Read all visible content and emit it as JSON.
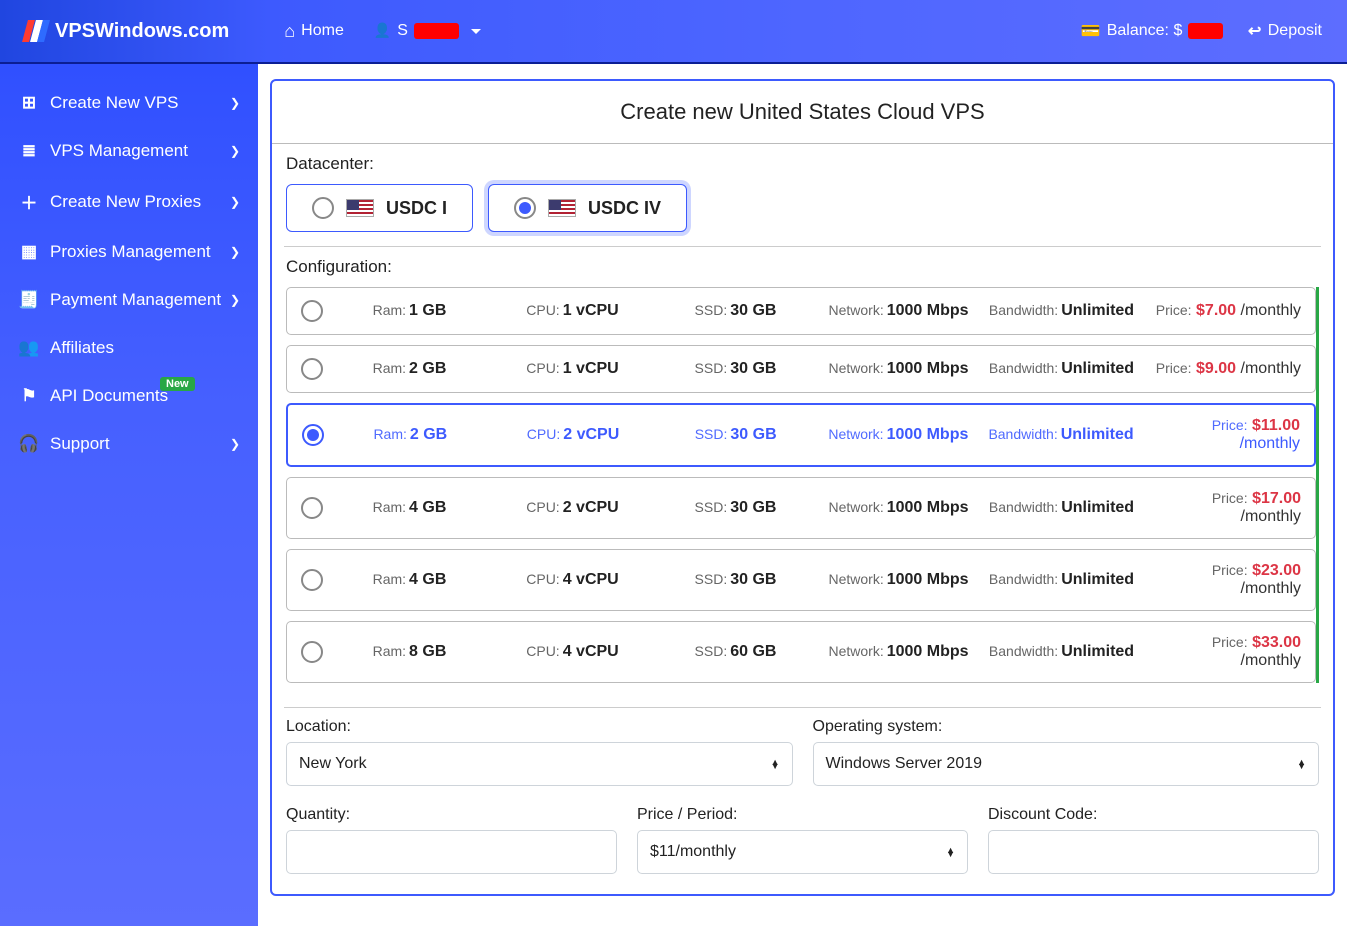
{
  "brand": "VPSWindows.com",
  "topnav": {
    "home": "Home",
    "balance_label": "Balance: $",
    "deposit": "Deposit"
  },
  "sidebar": {
    "items": [
      {
        "icon": "⊞",
        "label": "Create New VPS",
        "chev": true
      },
      {
        "icon": "≣",
        "label": "VPS Management",
        "chev": true
      },
      {
        "icon": "＋",
        "label": "Create New Proxies",
        "chev": true
      },
      {
        "icon": "▦",
        "label": "Proxies Management",
        "chev": true
      },
      {
        "icon": "🧾",
        "label": "Payment Management",
        "chev": true
      },
      {
        "icon": "👥",
        "label": "Affiliates",
        "chev": false
      },
      {
        "icon": "⚑",
        "label": "API Documents",
        "chev": false,
        "badge": "New"
      },
      {
        "icon": "🎧",
        "label": "Support",
        "chev": true
      }
    ]
  },
  "page": {
    "title": "Create new United States Cloud VPS",
    "datacenter_label": "Datacenter:",
    "datacenters": [
      {
        "name": "USDC I",
        "selected": false
      },
      {
        "name": "USDC IV",
        "selected": true
      }
    ],
    "config_label": "Configuration:",
    "configs": [
      {
        "ram": "1 GB",
        "cpu": "1 vCPU",
        "ssd": "30 GB",
        "net": "1000 Mbps",
        "bw": "Unlimited",
        "price": "$7.00",
        "period": "/monthly",
        "selected": false
      },
      {
        "ram": "2 GB",
        "cpu": "1 vCPU",
        "ssd": "30 GB",
        "net": "1000 Mbps",
        "bw": "Unlimited",
        "price": "$9.00",
        "period": "/monthly",
        "selected": false
      },
      {
        "ram": "2 GB",
        "cpu": "2 vCPU",
        "ssd": "30 GB",
        "net": "1000 Mbps",
        "bw": "Unlimited",
        "price": "$11.00",
        "period": "/monthly",
        "selected": true
      },
      {
        "ram": "4 GB",
        "cpu": "2 vCPU",
        "ssd": "30 GB",
        "net": "1000 Mbps",
        "bw": "Unlimited",
        "price": "$17.00",
        "period": "/monthly",
        "selected": false
      },
      {
        "ram": "4 GB",
        "cpu": "4 vCPU",
        "ssd": "30 GB",
        "net": "1000 Mbps",
        "bw": "Unlimited",
        "price": "$23.00",
        "period": "/monthly",
        "selected": false
      },
      {
        "ram": "8 GB",
        "cpu": "4 vCPU",
        "ssd": "60 GB",
        "net": "1000 Mbps",
        "bw": "Unlimited",
        "price": "$33.00",
        "period": "/monthly",
        "selected": false
      }
    ],
    "labels": {
      "ram": "Ram:",
      "cpu": "CPU:",
      "ssd": "SSD:",
      "net": "Network:",
      "bw": "Bandwidth:",
      "price": "Price:"
    },
    "location_label": "Location:",
    "location_value": "New York",
    "os_label": "Operating system:",
    "os_value": "Windows Server 2019",
    "qty_label": "Quantity:",
    "qty_value": "",
    "priceperiod_label": "Price / Period:",
    "priceperiod_value": "$11/monthly",
    "discount_label": "Discount Code:",
    "discount_value": ""
  }
}
